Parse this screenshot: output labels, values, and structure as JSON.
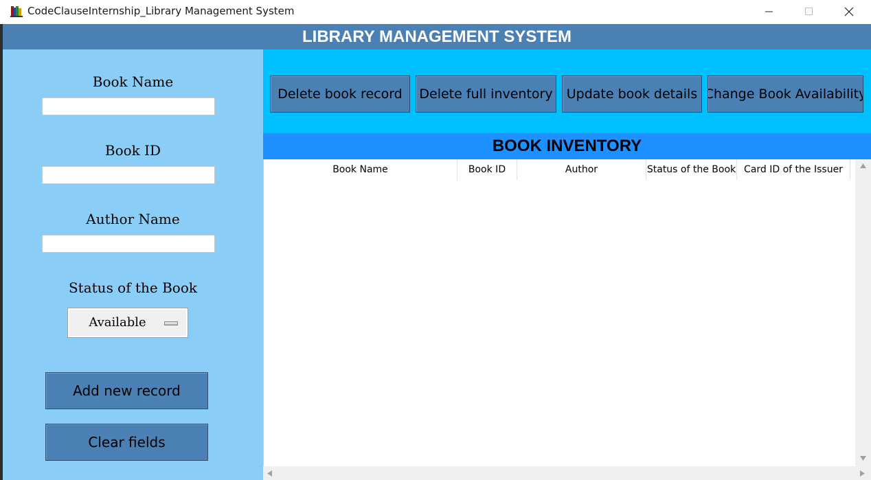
{
  "window": {
    "title": "CodeClauseInternship_Library Management System",
    "icon": "books-icon",
    "controls": [
      "minimize-icon",
      "maximize-icon",
      "close-icon"
    ]
  },
  "header": {
    "title": "LIBRARY MANAGEMENT SYSTEM"
  },
  "form": {
    "book_name_label": "Book Name",
    "book_name_value": "",
    "book_id_label": "Book ID",
    "book_id_value": "",
    "author_label": "Author Name",
    "author_value": "",
    "status_label": "Status of the Book",
    "status_selected": "Available",
    "add_button": "Add new record",
    "clear_button": "Clear fields"
  },
  "actions": {
    "delete_record": "Delete book record",
    "delete_inventory": "Delete full inventory",
    "update_details": "Update book details",
    "change_availability": "Change Book Availability"
  },
  "inventory": {
    "title": "BOOK INVENTORY",
    "columns": [
      "Book Name",
      "Book ID",
      "Author",
      "Status of the Book",
      "Card ID of the Issuer"
    ],
    "rows": []
  },
  "colors": {
    "header_bg": "#4a80b4",
    "left_panel_bg": "#8acef8",
    "right_top_bg": "#00bfff",
    "inventory_header_bg": "#1e90ff",
    "button_bg": "#4a80b4"
  }
}
